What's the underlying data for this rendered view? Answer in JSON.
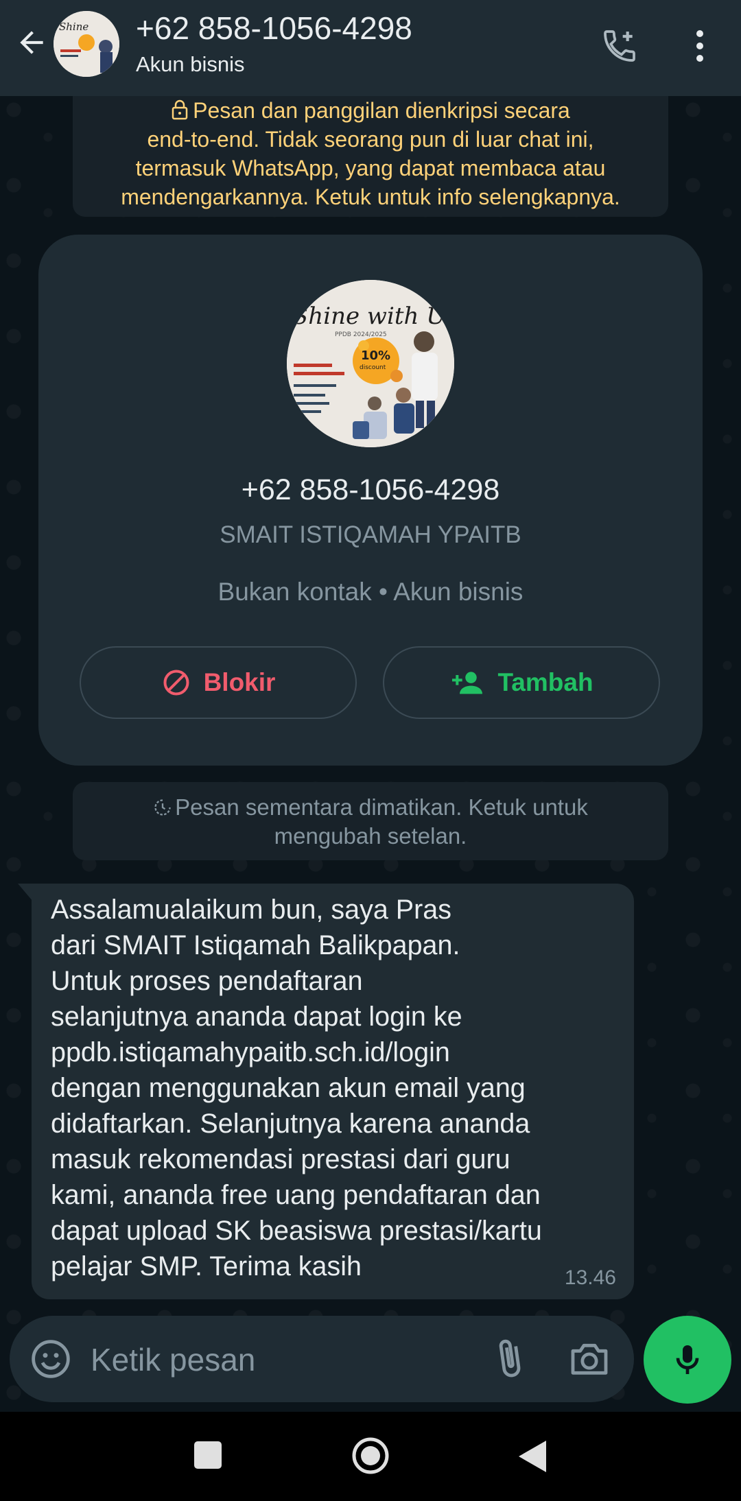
{
  "header": {
    "title": "+62 858-1056-4298",
    "subtitle": "Akun bisnis",
    "icons": {
      "back": "arrow-left-icon",
      "call": "add-call-icon",
      "menu": "more-vert-icon"
    }
  },
  "encryption_notice": {
    "lines": [
      "Pesan dan panggilan dienkripsi secara",
      "end-to-end. Tidak seorang pun di luar chat ini,",
      "termasuk WhatsApp, yang dapat membaca atau",
      "mendengarkannya. Ketuk untuk info selengkapnya."
    ],
    "icon": "lock-icon",
    "color": "#ffd279"
  },
  "contact_card": {
    "phone": "+62 858-1056-4298",
    "name": "SMAIT ISTIQAMAH YPAITB",
    "meta": "Bukan kontak • Akun bisnis",
    "avatar_text": "Shine with Us",
    "block_label": "Blokir",
    "add_label": "Tambah",
    "block_color": "#f15c6d",
    "add_color": "#21c063"
  },
  "disappearing_notice": {
    "lines": [
      "Pesan sementara dimatikan. Ketuk untuk",
      "mengubah setelan."
    ],
    "icon": "timer-icon"
  },
  "message": {
    "lines": [
      "Assalamualaikum bun, saya Pras",
      "dari SMAIT Istiqamah Balikpapan.",
      "Untuk proses pendaftaran",
      "selanjutnya ananda dapat login ke",
      "ppdb.istiqamahypaitb.sch.id/login",
      "dengan menggunakan akun email yang",
      "didaftarkan. Selanjutnya karena ananda",
      "masuk rekomendasi prestasi dari guru",
      "kami, ananda free uang pendaftaran dan",
      "dapat upload SK beasiswa prestasi/kartu",
      "pelajar SMP. Terima kasih"
    ],
    "time": "13.46"
  },
  "input_bar": {
    "placeholder": "Ketik pesan",
    "icons": {
      "emoji": "emoji-icon",
      "attach": "paperclip-icon",
      "camera": "camera-icon",
      "mic": "mic-icon"
    },
    "accent": "#21c063"
  },
  "nav_bar": {
    "icons": [
      "recent-apps-icon",
      "home-icon",
      "back-icon"
    ]
  }
}
